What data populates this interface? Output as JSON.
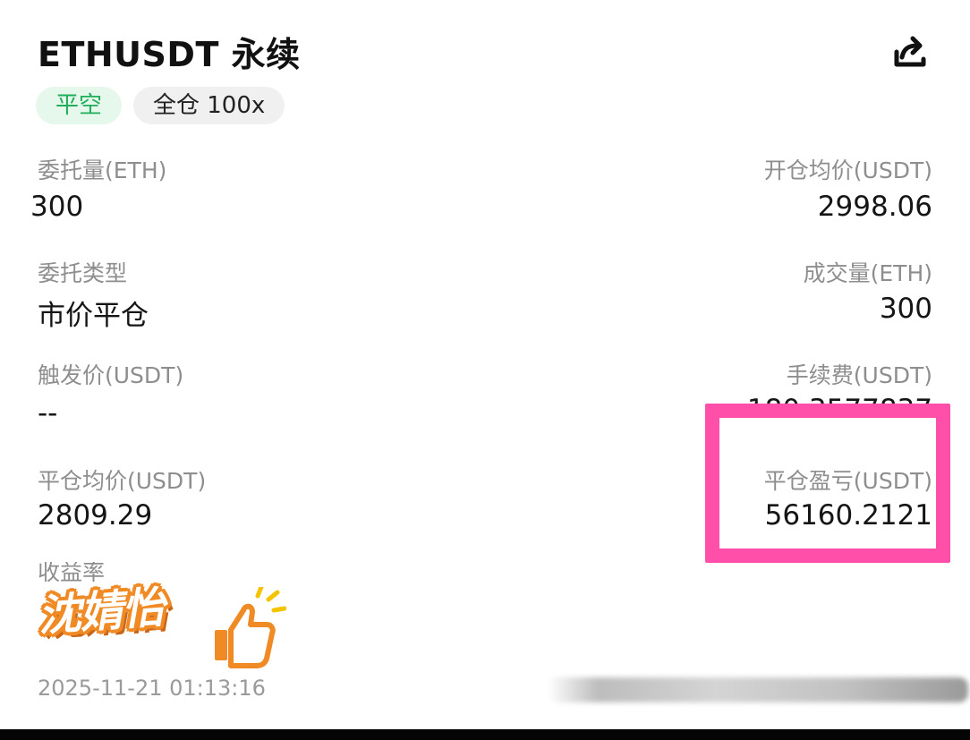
{
  "header": {
    "title": "ETHUSDT 永续",
    "share_icon": "share-icon"
  },
  "tags": {
    "direction": "平空",
    "mode": "全仓 100x"
  },
  "fields": {
    "order_qty_label": "委托量(ETH)",
    "order_qty_value": "300",
    "open_avg_label": "开仓均价(USDT)",
    "open_avg_value": "2998.06",
    "order_type_label": "委托类型",
    "order_type_value": "市价平仓",
    "filled_qty_label": "成交量(ETH)",
    "filled_qty_value": "300",
    "trigger_price_label": "触发价(USDT)",
    "trigger_price_value": "--",
    "fee_label": "手续费(USDT)",
    "fee_value_partial": "180.3577837",
    "close_avg_label": "平仓均价(USDT)",
    "close_avg_value": "2809.29",
    "close_pnl_label": "平仓盈亏(USDT)",
    "close_pnl_value": "56160.2121",
    "yield_label_partial": "收益率"
  },
  "sticker": {
    "text": "沈婧怡",
    "icon": "thumbs-up-icon"
  },
  "footer": {
    "timestamp": "2025-11-21 01:13:16"
  },
  "colors": {
    "tag_close_bg": "#e6f7ec",
    "tag_close_text": "#1fae5a",
    "highlight": "#ff4fa8",
    "sticker_outline": "#f08a24"
  }
}
